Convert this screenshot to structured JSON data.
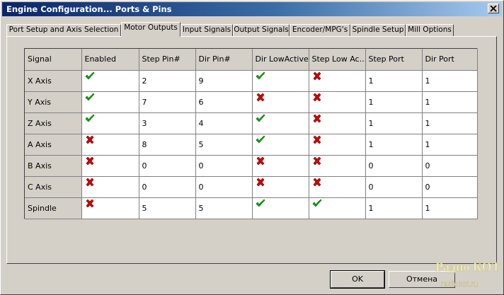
{
  "window": {
    "title": "Engine Configuration... Ports & Pins"
  },
  "tabs": [
    {
      "label": "Port Setup and Axis Selection"
    },
    {
      "label": "Motor Outputs"
    },
    {
      "label": "Input Signals"
    },
    {
      "label": "Output Signals"
    },
    {
      "label": "Encoder/MPG's"
    },
    {
      "label": "Spindle Setup"
    },
    {
      "label": "Mill Options"
    }
  ],
  "active_tab": "Motor Outputs",
  "table": {
    "headers": [
      "Signal",
      "Enabled",
      "Step Pin#",
      "Dir Pin#",
      "Dir LowActive",
      "Step Low Ac...",
      "Step Port",
      "Dir Port"
    ],
    "rows": [
      {
        "signal": "X Axis",
        "enabled": true,
        "step_pin": "2",
        "dir_pin": "9",
        "dir_low_active": true,
        "step_low_active": false,
        "step_port": "1",
        "dir_port": "1"
      },
      {
        "signal": "Y Axis",
        "enabled": true,
        "step_pin": "7",
        "dir_pin": "6",
        "dir_low_active": false,
        "step_low_active": false,
        "step_port": "1",
        "dir_port": "1"
      },
      {
        "signal": "Z Axis",
        "enabled": true,
        "step_pin": "3",
        "dir_pin": "4",
        "dir_low_active": true,
        "step_low_active": false,
        "step_port": "1",
        "dir_port": "1"
      },
      {
        "signal": "A Axis",
        "enabled": false,
        "step_pin": "8",
        "dir_pin": "5",
        "dir_low_active": true,
        "step_low_active": false,
        "step_port": "1",
        "dir_port": "1"
      },
      {
        "signal": "B Axis",
        "enabled": false,
        "step_pin": "0",
        "dir_pin": "0",
        "dir_low_active": false,
        "step_low_active": false,
        "step_port": "0",
        "dir_port": "0"
      },
      {
        "signal": "C Axis",
        "enabled": false,
        "step_pin": "0",
        "dir_pin": "0",
        "dir_low_active": false,
        "step_low_active": false,
        "step_port": "0",
        "dir_port": "0"
      },
      {
        "signal": "Spindle",
        "enabled": false,
        "step_pin": "5",
        "dir_pin": "5",
        "dir_low_active": true,
        "step_low_active": true,
        "step_port": "1",
        "dir_port": "1"
      }
    ]
  },
  "buttons": {
    "ok": "OK",
    "cancel": "Отмена"
  },
  "watermark": {
    "line1": "Радио КОТ",
    "line2": "radiokot.ru"
  },
  "icons": {
    "check": "green-check-icon",
    "cross": "red-cross-icon"
  },
  "colors": {
    "check": "#00b000",
    "cross": "#d00000",
    "title_start": "#0a246a",
    "title_end": "#a6caf0"
  }
}
